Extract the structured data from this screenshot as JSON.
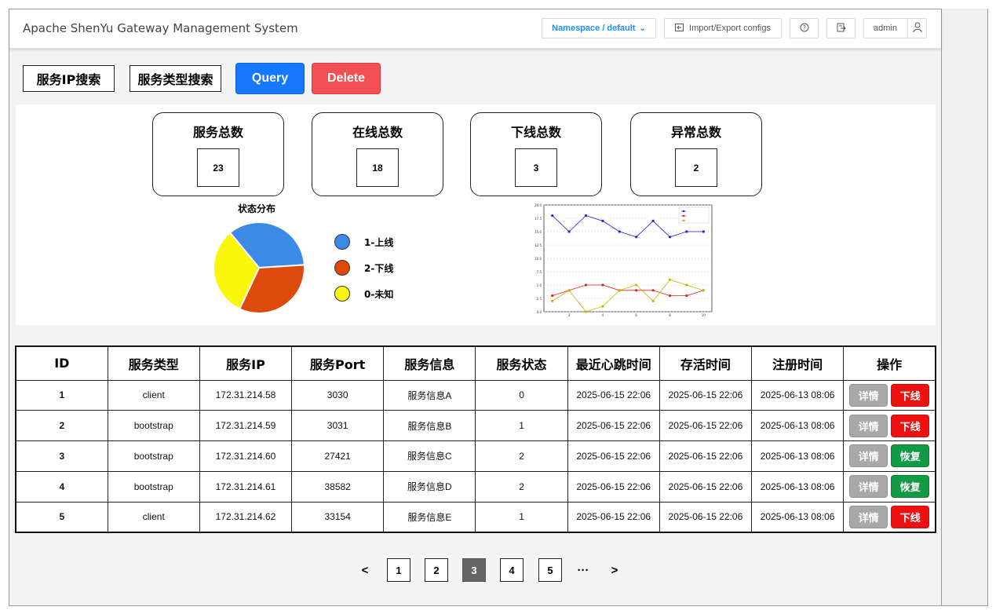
{
  "header": {
    "title": "Apache ShenYu Gateway Management System",
    "namespace_label": "Namespace / default",
    "import_export_label": "Import/Export configs",
    "user": "admin"
  },
  "search": {
    "ip_label": "服务IP搜索",
    "type_label": "服务类型搜索",
    "query_label": "Query",
    "delete_label": "Delete"
  },
  "stats": [
    {
      "label": "服务总数",
      "value": "23"
    },
    {
      "label": "在线总数",
      "value": "18"
    },
    {
      "label": "下线总数",
      "value": "3"
    },
    {
      "label": "异常总数",
      "value": "2"
    }
  ],
  "pie": {
    "title": "状态分布",
    "legend": [
      {
        "label": "1-上线",
        "color": "#3b8be6"
      },
      {
        "label": "2-下线",
        "color": "#dd4a0c"
      },
      {
        "label": "0-未知",
        "color": "#fbf70c"
      }
    ]
  },
  "chart_data": [
    {
      "type": "pie",
      "title": "状态分布",
      "labels": [
        "1-上线",
        "2-下线",
        "0-未知"
      ],
      "values": [
        35,
        33,
        32
      ],
      "colors": [
        "#3b8be6",
        "#dd4a0c",
        "#fbf70c"
      ]
    },
    {
      "type": "line",
      "x": [
        1,
        2,
        3,
        4,
        5,
        6,
        7,
        8,
        9,
        10
      ],
      "series": [
        {
          "values": [
            18,
            15,
            18,
            17,
            15,
            14,
            17,
            14,
            15,
            15
          ],
          "color": "#1f1fe0"
        },
        {
          "values": [
            3,
            4,
            5,
            5,
            4,
            4,
            4,
            3,
            3,
            4
          ],
          "color": "#e01f1f"
        },
        {
          "values": [
            2,
            4,
            0,
            1,
            4,
            5,
            2,
            6,
            5,
            4
          ],
          "color": "#c8b400"
        }
      ],
      "ylim": [
        0,
        20
      ],
      "yticks": [
        "0.0",
        "2.5",
        "5.0",
        "7.5",
        "10.0",
        "12.5",
        "15.0",
        "17.5",
        "20.0"
      ],
      "xticks": [
        "2",
        "4",
        "6",
        "8",
        "10"
      ],
      "grid": true,
      "legend_position": "top-right"
    }
  ],
  "table": {
    "columns": [
      "ID",
      "服务类型",
      "服务IP",
      "服务Port",
      "服务信息",
      "服务状态",
      "最近心跳时间",
      "存活时间",
      "注册时间",
      "操作"
    ],
    "rows": [
      {
        "id": "1",
        "type": "client",
        "ip": "172.31.214.58",
        "port": "3030",
        "info": "服务信息A",
        "status": "0",
        "heartbeat": "2025-06-15 22:06",
        "alive": "2025-06-15 22:06",
        "registered": "2025-06-13 08:06",
        "detail": "详情",
        "action": "下线",
        "action_color": "#ee1111"
      },
      {
        "id": "2",
        "type": "bootstrap",
        "ip": "172.31.214.59",
        "port": "3031",
        "info": "服务信息B",
        "status": "1",
        "heartbeat": "2025-06-15 22:06",
        "alive": "2025-06-15 22:06",
        "registered": "2025-06-13 08:06",
        "detail": "详情",
        "action": "下线",
        "action_color": "#ee1111"
      },
      {
        "id": "3",
        "type": "bootstrap",
        "ip": "172.31.214.60",
        "port": "27421",
        "info": "服务信息C",
        "status": "2",
        "heartbeat": "2025-06-15 22:06",
        "alive": "2025-06-15 22:06",
        "registered": "2025-06-13 08:06",
        "detail": "详情",
        "action": "恢复",
        "action_color": "#129a45"
      },
      {
        "id": "4",
        "type": "bootstrap",
        "ip": "172.31.214.61",
        "port": "38582",
        "info": "服务信息D",
        "status": "2",
        "heartbeat": "2025-06-15 22:06",
        "alive": "2025-06-15 22:06",
        "registered": "2025-06-13 08:06",
        "detail": "详情",
        "action": "恢复",
        "action_color": "#129a45"
      },
      {
        "id": "5",
        "type": "client",
        "ip": "172.31.214.62",
        "port": "33154",
        "info": "服务信息E",
        "status": "1",
        "heartbeat": "2025-06-15 22:06",
        "alive": "2025-06-15 22:06",
        "registered": "2025-06-13 08:06",
        "detail": "详情",
        "action": "下线",
        "action_color": "#ee1111"
      }
    ]
  },
  "pagination": {
    "prev": "<",
    "pages": [
      "1",
      "2",
      "3",
      "4",
      "5"
    ],
    "current": "3",
    "ellipsis": "···",
    "next": ">"
  }
}
